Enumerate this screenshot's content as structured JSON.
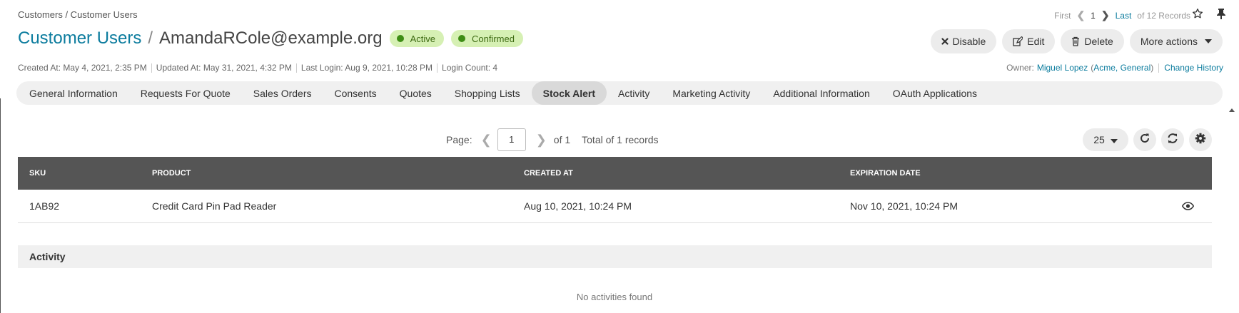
{
  "breadcrumb": "Customers / Customer Users",
  "pager_top": {
    "first": "First",
    "current": "1",
    "last": "Last",
    "records": "of 12 Records"
  },
  "header": {
    "entity": "Customer Users",
    "separator": "/",
    "record": "AmandaRCole@example.org",
    "badges": [
      "Active",
      "Confirmed"
    ]
  },
  "actions": {
    "disable": "Disable",
    "edit": "Edit",
    "delete": "Delete",
    "more": "More actions"
  },
  "meta": {
    "created": "Created At: May 4, 2021, 2:35 PM",
    "updated": "Updated At: May 31, 2021, 4:32 PM",
    "last_login": "Last Login: Aug 9, 2021, 10:28 PM",
    "login_count": "Login Count: 4"
  },
  "owner": {
    "label": "Owner:",
    "name": "Miguel Lopez",
    "org_open": "(",
    "org": "Acme, General",
    "org_close": ")",
    "change_history": "Change History"
  },
  "tabs": [
    "General Information",
    "Requests For Quote",
    "Sales Orders",
    "Consents",
    "Quotes",
    "Shopping Lists",
    "Stock Alert",
    "Activity",
    "Marketing Activity",
    "Additional Information",
    "OAuth Applications"
  ],
  "active_tab": "Stock Alert",
  "grid_pager": {
    "label": "Page:",
    "page": "1",
    "of": "of 1",
    "total": "Total of 1 records",
    "page_size": "25"
  },
  "table": {
    "columns": [
      "SKU",
      "PRODUCT",
      "CREATED AT",
      "EXPIRATION DATE"
    ],
    "rows": [
      {
        "sku": "1AB92",
        "product": "Credit Card Pin Pad Reader",
        "created_at": "Aug 10, 2021, 10:24 PM",
        "expiration_date": "Nov 10, 2021, 10:24 PM"
      }
    ]
  },
  "activity": {
    "title": "Activity",
    "empty": "No activities found"
  },
  "colors": {
    "link": "#0c7c9e",
    "badge_bg": "#d6f0b4",
    "badge_dot": "#3d8d14",
    "table_header": "#555555"
  }
}
